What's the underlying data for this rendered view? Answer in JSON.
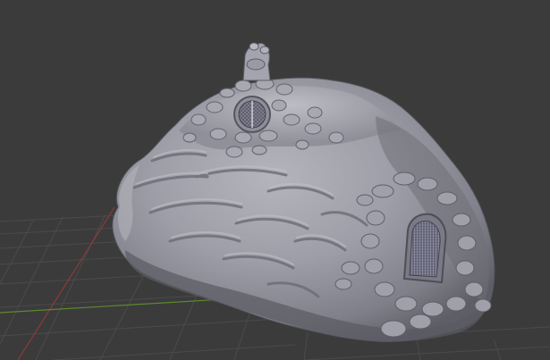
{
  "app": "blender-3d-viewport",
  "viewport": {
    "background_color": "#3b3b3b",
    "grid_color": "#4d4d4d",
    "x_axis_color": "#9a3b3b",
    "y_axis_color": "#5d8a2e",
    "model": {
      "name": "",
      "type": "sculpted-rock-dwelling",
      "material_color": "#9c9ca6",
      "features": [
        "roof-window-icon",
        "side-door-icon",
        "chimney-icon"
      ]
    }
  }
}
